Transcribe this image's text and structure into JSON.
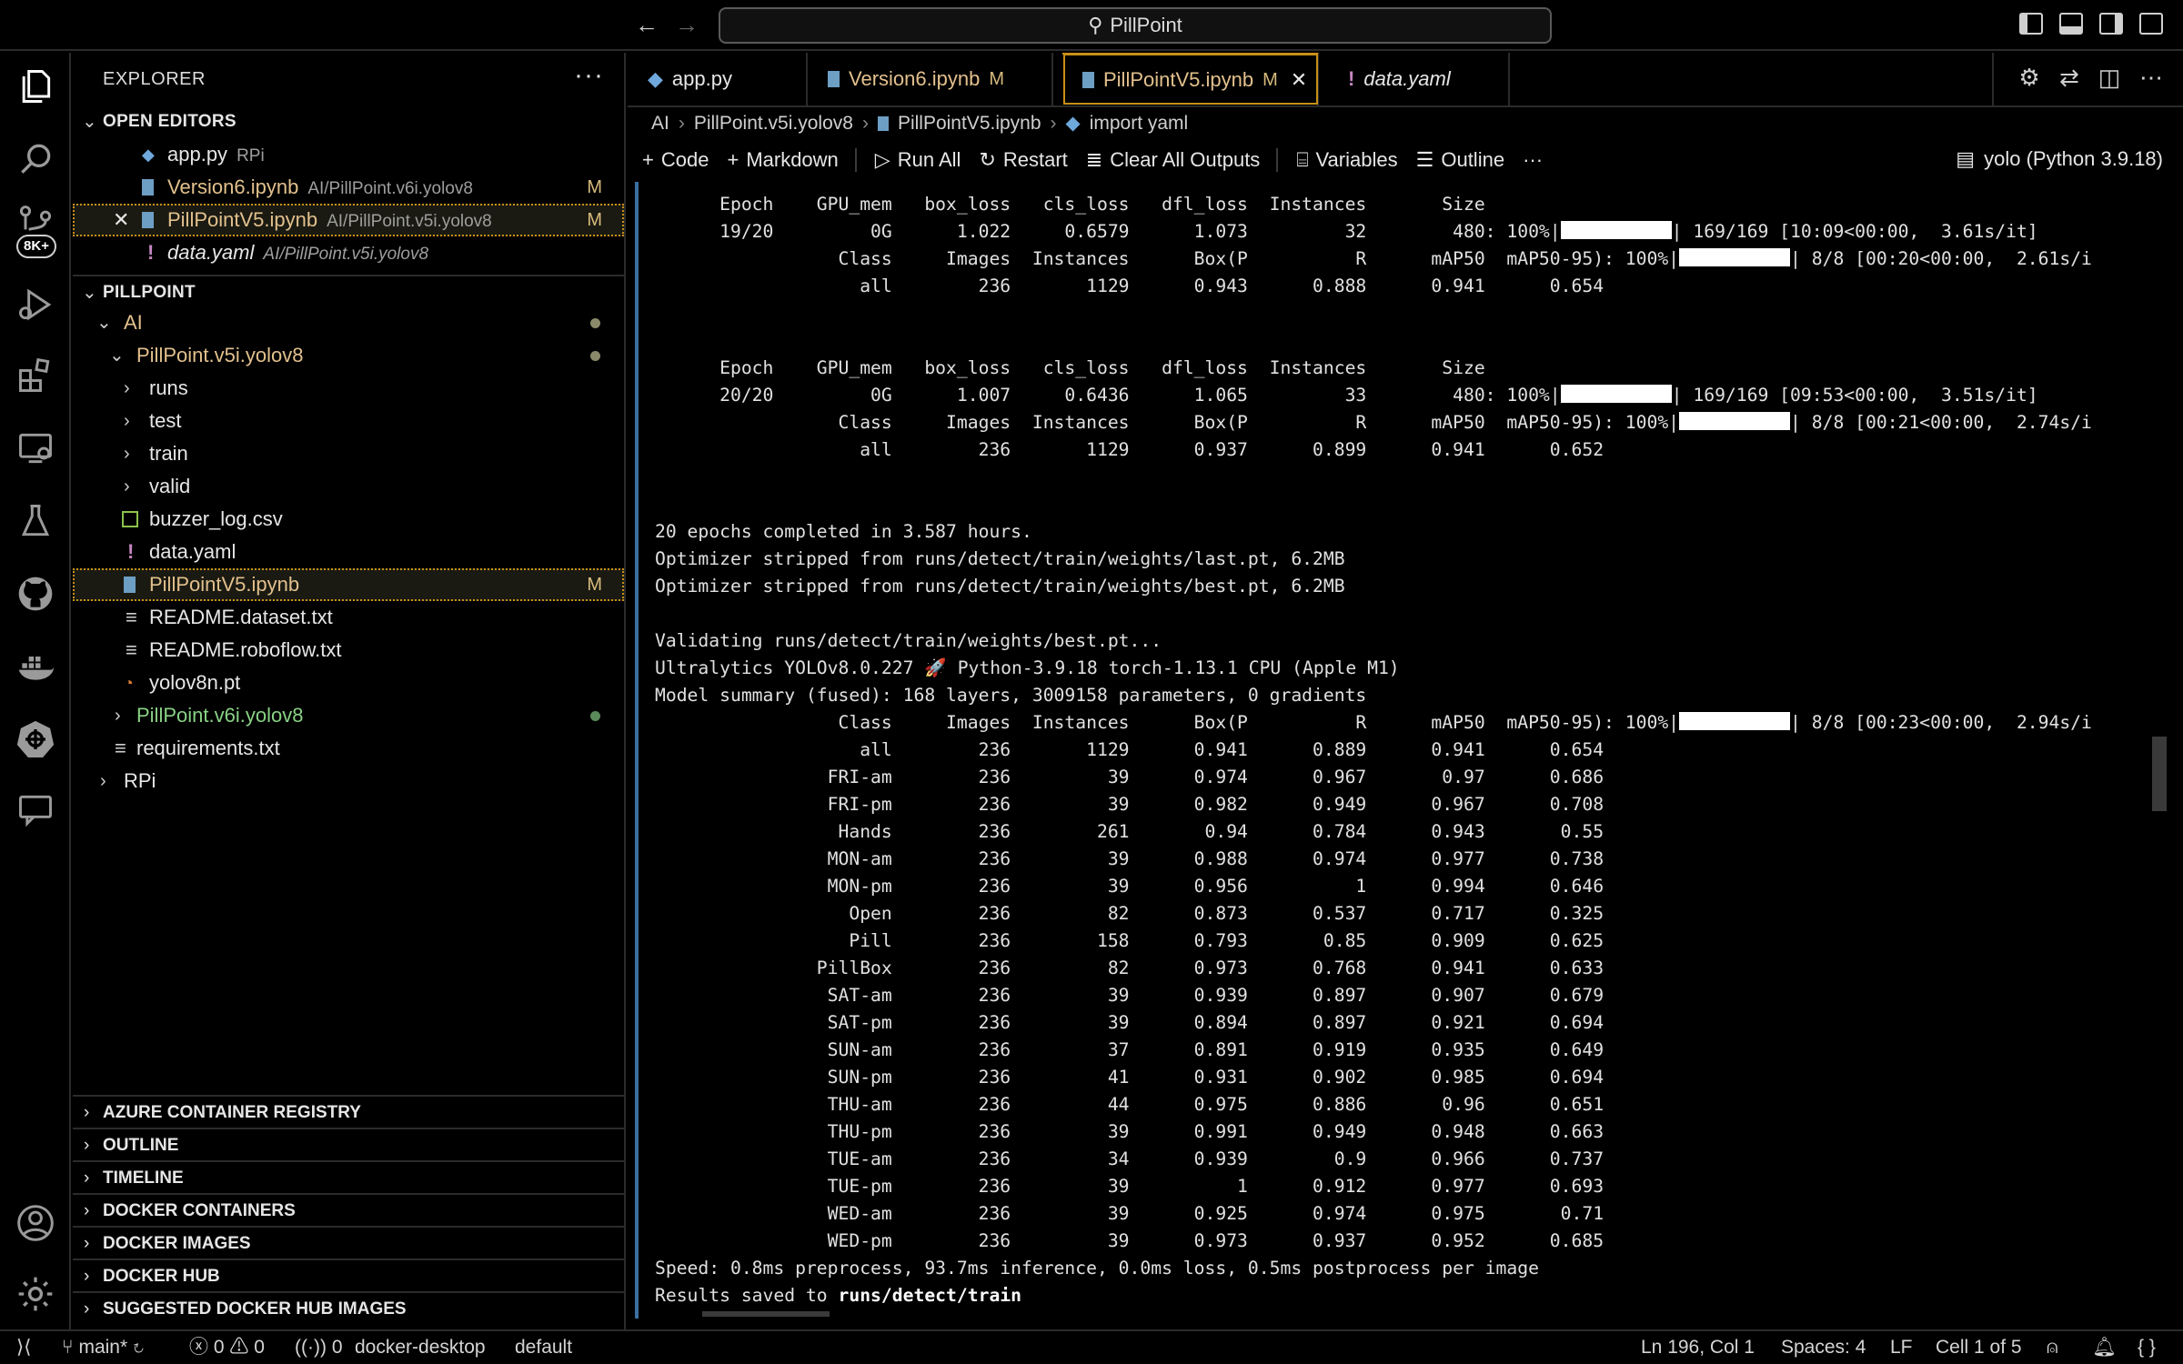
{
  "titlebar": {
    "search_text": "PillPoint"
  },
  "activity": {
    "badge": "8K+"
  },
  "sidebar": {
    "title": "EXPLORER",
    "more": "···",
    "open_editors_header": "OPEN EDITORS",
    "open_editors": [
      {
        "name": "app.py",
        "desc": "RPi",
        "status": ""
      },
      {
        "name": "Version6.ipynb",
        "desc": "AI/PillPoint.v6i.yolov8",
        "status": "M"
      },
      {
        "name": "PillPointV5.ipynb",
        "desc": "AI/PillPoint.v5i.yolov8",
        "status": "M"
      },
      {
        "name": "data.yaml",
        "desc": "AI/PillPoint.v5i.yolov8",
        "status": ""
      }
    ],
    "project_header": "PILLPOINT",
    "tree": [
      "AI",
      "PillPoint.v5i.yolov8",
      "runs",
      "test",
      "train",
      "valid",
      "buzzer_log.csv",
      "data.yaml",
      "PillPointV5.ipynb",
      "README.dataset.txt",
      "README.roboflow.txt",
      "yolov8n.pt",
      "PillPoint.v6i.yolov8",
      "requirements.txt",
      "RPi"
    ],
    "tree_status_m": "M",
    "sections": [
      "AZURE CONTAINER REGISTRY",
      "OUTLINE",
      "TIMELINE",
      "DOCKER CONTAINERS",
      "DOCKER IMAGES",
      "DOCKER HUB",
      "SUGGESTED DOCKER HUB IMAGES"
    ]
  },
  "tabs": [
    {
      "label": "app.py",
      "status": ""
    },
    {
      "label": "Version6.ipynb",
      "status": "M"
    },
    {
      "label": "PillPointV5.ipynb",
      "status": "M"
    },
    {
      "label": "data.yaml",
      "status": ""
    }
  ],
  "breadcrumb": [
    "AI",
    "PillPoint.v5i.yolov8",
    "PillPointV5.ipynb",
    "import yaml"
  ],
  "toolbar": {
    "code": "Code",
    "markdown": "Markdown",
    "run_all": "Run All",
    "restart": "Restart",
    "clear": "Clear All Outputs",
    "variables": "Variables",
    "outline": "Outline",
    "more": "···",
    "kernel": "yolo (Python 3.9.18)"
  },
  "output": {
    "epoch19": [
      "      Epoch    GPU_mem   box_loss   cls_loss   dfl_loss  Instances       Size",
      "      19/20         0G      1.022     0.6579      1.073         32        480: 100%|",
      "| 169/169 [10:09<00:00,  3.61s/it]",
      "                 Class     Images  Instances      Box(P          R      mAP50  mAP50-95): 100%|",
      "| 8/8 [00:20<00:00,  2.61s/i",
      "                   all        236       1129      0.943      0.888      0.941      0.654"
    ],
    "epoch20": [
      "      Epoch    GPU_mem   box_loss   cls_loss   dfl_loss  Instances       Size",
      "      20/20         0G      1.007     0.6436      1.065         33        480: 100%|",
      "| 169/169 [09:53<00:00,  3.51s/it]",
      "                 Class     Images  Instances      Box(P          R      mAP50  mAP50-95): 100%|",
      "| 8/8 [00:21<00:00,  2.74s/i",
      "                   all        236       1129      0.937      0.899      0.941      0.652"
    ],
    "summary": [
      "20 epochs completed in 3.587 hours.",
      "Optimizer stripped from runs/detect/train/weights/last.pt, 6.2MB",
      "Optimizer stripped from runs/detect/train/weights/best.pt, 6.2MB",
      "",
      "Validating runs/detect/train/weights/best.pt...",
      "Ultralytics YOLOv8.0.227 🚀 Python-3.9.18 torch-1.13.1 CPU (Apple M1)",
      "Model summary (fused): 168 layers, 3009158 parameters, 0 gradients"
    ],
    "val_header": "                 Class     Images  Instances      Box(P          R      mAP50  mAP50-95): 100%|",
    "val_header_tail": "| 8/8 [00:23<00:00,  2.94s/i",
    "val_rows": [
      "                   all        236       1129      0.941      0.889      0.941      0.654",
      "                FRI-am        236         39      0.974      0.967       0.97      0.686",
      "                FRI-pm        236         39      0.982      0.949      0.967      0.708",
      "                 Hands        236        261       0.94      0.784      0.943       0.55",
      "                MON-am        236         39      0.988      0.974      0.977      0.738",
      "                MON-pm        236         39      0.956          1      0.994      0.646",
      "                  Open        236         82      0.873      0.537      0.717      0.325",
      "                  Pill        236        158      0.793       0.85      0.909      0.625",
      "               PillBox        236         82      0.973      0.768      0.941      0.633",
      "                SAT-am        236         39      0.939      0.897      0.907      0.679",
      "                SAT-pm        236         39      0.894      0.897      0.921      0.694",
      "                SUN-am        236         37      0.891      0.919      0.935      0.649",
      "                SUN-pm        236         41      0.931      0.902      0.985      0.694",
      "                THU-am        236         44      0.975      0.886       0.96      0.651",
      "                THU-pm        236         39      0.991      0.949      0.948      0.663",
      "                TUE-am        236         34      0.939        0.9      0.966      0.737",
      "                TUE-pm        236         39          1      0.912      0.977      0.693",
      "                WED-am        236         39      0.925      0.974      0.975       0.71",
      "                WED-pm        236         39      0.973      0.937      0.952      0.685"
    ],
    "speed": "Speed: 0.8ms preprocess, 93.7ms inference, 0.0ms loss, 0.5ms postprocess per image",
    "results_prefix": "Results saved to ",
    "results_path": "runs/detect/train"
  },
  "statusbar": {
    "branch": "main*",
    "errors": "0",
    "warnings": "0",
    "ports": "0",
    "docker": "docker-desktop",
    "default": "default",
    "position": "Ln 196, Col 1",
    "spaces": "Spaces: 4",
    "eol": "LF",
    "cell": "Cell 1 of 5"
  }
}
